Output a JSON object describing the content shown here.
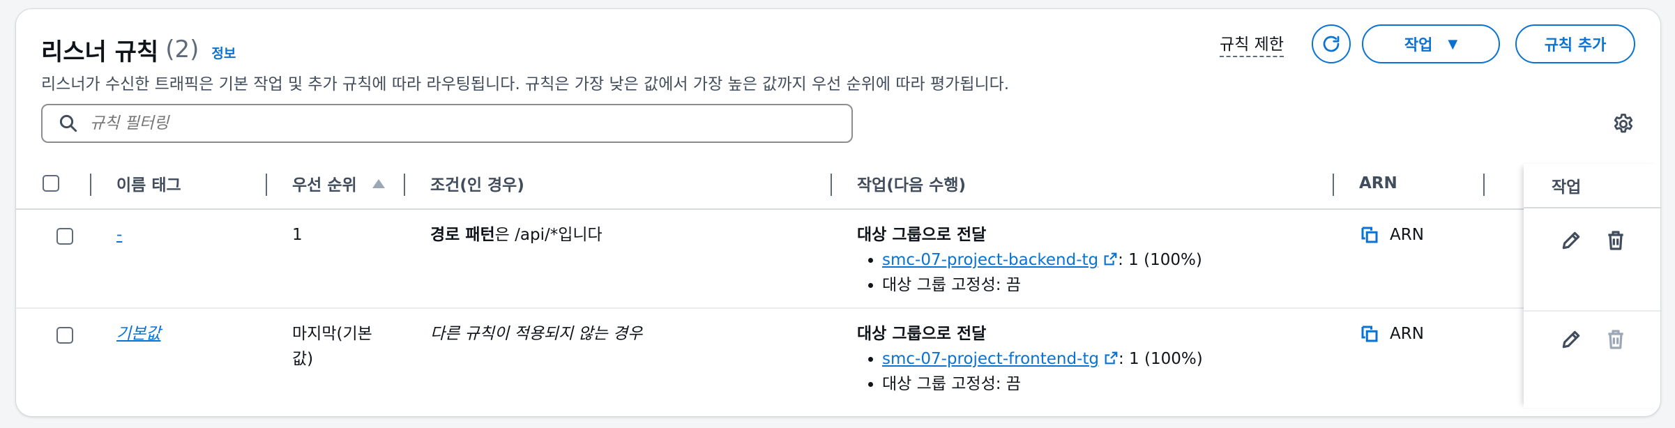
{
  "header": {
    "title": "리스너 규칙",
    "count": "(2)",
    "info": "정보",
    "description": "리스너가 수신한 트래픽은 기본 작업 및 추가 규칙에 따라 라우팅됩니다. 규칙은 가장 낮은 값에서 가장 높은 값까지 우선 순위에 따라 평가됩니다."
  },
  "toolbar": {
    "limit_label": "규칙 제한",
    "refresh_icon": "refresh-icon",
    "action_label": "작업",
    "add_label": "규칙 추가"
  },
  "search": {
    "placeholder": "규칙 필터링"
  },
  "table": {
    "columns": [
      "이름 태그",
      "우선 순위",
      "조건(인 경우)",
      "작업(다음 수행)",
      "ARN",
      "작업"
    ],
    "sorted_column": "우선 순위",
    "rows": [
      {
        "name": "-",
        "priority": "1",
        "condition_bold": "경로 패턴",
        "condition_rest": "은 /api/*입니다",
        "action_title": "대상 그룹으로 전달",
        "target_group": "smc-07-project-backend-tg",
        "weight": ": 1 (100%)",
        "stickiness": "대상 그룹 고정성: 끔",
        "arn": "ARN",
        "delete_enabled": true
      },
      {
        "name": "기본값",
        "priority_line1": "마지막(기본",
        "priority_line2": "값)",
        "condition": "다른 규칙이 적용되지 않는 경우",
        "action_title": "대상 그룹으로 전달",
        "target_group": "smc-07-project-frontend-tg",
        "weight": ": 1 (100%)",
        "stickiness": "대상 그룹 고정성: 끔",
        "arn": "ARN",
        "delete_enabled": false
      }
    ]
  },
  "colors": {
    "accent": "#0972d3",
    "text": "#0f141a",
    "muted": "#414d5c",
    "disabled": "#9ba7b6"
  }
}
